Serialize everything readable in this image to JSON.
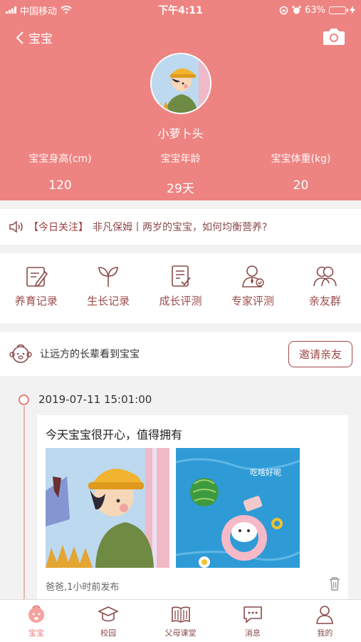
{
  "status_bar": {
    "carrier": "中国移动",
    "time": "下午4:11",
    "battery_percent": "63%",
    "battery_level": 0.63
  },
  "header": {
    "back_label": "宝宝",
    "baby_name": "小萝卜头",
    "stats": [
      {
        "label": "宝宝身高(cm)",
        "value": "120"
      },
      {
        "label": "宝宝年龄",
        "value": "29天"
      },
      {
        "label": "宝宝体重(kg)",
        "value": "20"
      }
    ]
  },
  "notice": {
    "tag": "【今日关注】",
    "text": "非凡保姆丨两岁的宝宝，如何均衡营养?"
  },
  "quick_menu": [
    {
      "label": "养育记录",
      "icon": "notebook-pencil-icon"
    },
    {
      "label": "生长记录",
      "icon": "sprout-icon"
    },
    {
      "label": "成长评测",
      "icon": "clipboard-check-icon"
    },
    {
      "label": "专家评测",
      "icon": "expert-person-icon"
    },
    {
      "label": "亲友群",
      "icon": "group-icon"
    }
  ],
  "invite": {
    "text": "让远方的长辈看到宝宝",
    "button": "邀请亲友"
  },
  "timeline": {
    "date": "2019-07-11 15:01:00",
    "post_text": "今天宝宝很开心，值得拥有",
    "image_caption": "吃啥好呢",
    "meta": "爸爸,1小时前发布"
  },
  "tabs": [
    {
      "label": "宝宝",
      "icon": "baby-face-icon",
      "active": true
    },
    {
      "label": "校园",
      "icon": "graduation-cap-icon",
      "active": false
    },
    {
      "label": "父母课堂",
      "icon": "open-book-icon",
      "active": false
    },
    {
      "label": "消息",
      "icon": "chat-bubble-icon",
      "active": false
    },
    {
      "label": "我的",
      "icon": "user-icon",
      "active": false
    }
  ],
  "colors": {
    "brand": "#ed8482",
    "accent_text": "#9c4b4b",
    "active_tab": "#e87a78"
  }
}
